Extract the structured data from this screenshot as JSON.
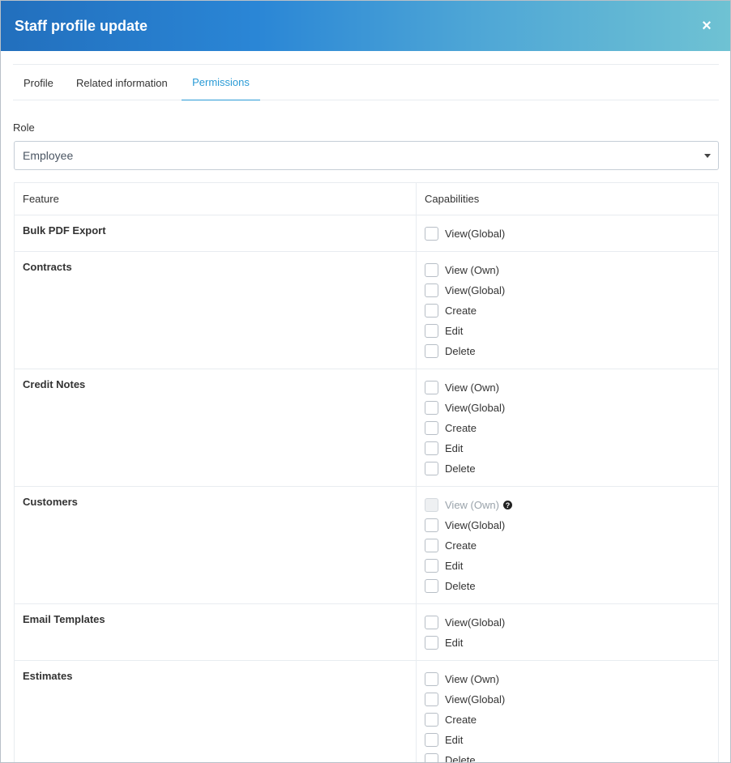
{
  "modal": {
    "title": "Staff profile update",
    "close_icon": "×"
  },
  "tabs": [
    {
      "label": "Profile",
      "active": false
    },
    {
      "label": "Related information",
      "active": false
    },
    {
      "label": "Permissions",
      "active": true
    }
  ],
  "role": {
    "label": "Role",
    "selected": "Employee"
  },
  "permissions": {
    "headers": {
      "feature": "Feature",
      "capabilities": "Capabilities"
    },
    "rows": [
      {
        "feature": "Bulk PDF Export",
        "caps": [
          {
            "label": "View(Global)"
          }
        ]
      },
      {
        "feature": "Contracts",
        "caps": [
          {
            "label": "View (Own)"
          },
          {
            "label": "View(Global)"
          },
          {
            "label": "Create"
          },
          {
            "label": "Edit"
          },
          {
            "label": "Delete"
          }
        ]
      },
      {
        "feature": "Credit Notes",
        "caps": [
          {
            "label": "View (Own)"
          },
          {
            "label": "View(Global)"
          },
          {
            "label": "Create"
          },
          {
            "label": "Edit"
          },
          {
            "label": "Delete"
          }
        ]
      },
      {
        "feature": "Customers",
        "caps": [
          {
            "label": "View (Own)",
            "disabled": true,
            "help": "?"
          },
          {
            "label": "View(Global)"
          },
          {
            "label": "Create"
          },
          {
            "label": "Edit"
          },
          {
            "label": "Delete"
          }
        ]
      },
      {
        "feature": "Email Templates",
        "caps": [
          {
            "label": "View(Global)"
          },
          {
            "label": "Edit"
          }
        ]
      },
      {
        "feature": "Estimates",
        "caps": [
          {
            "label": "View (Own)"
          },
          {
            "label": "View(Global)"
          },
          {
            "label": "Create"
          },
          {
            "label": "Edit"
          },
          {
            "label": "Delete"
          }
        ]
      }
    ]
  },
  "colors": {
    "header_gradient_start": "#226fbd",
    "header_gradient_end": "#6fc2d3",
    "active_tab": "#2a9bd6"
  }
}
